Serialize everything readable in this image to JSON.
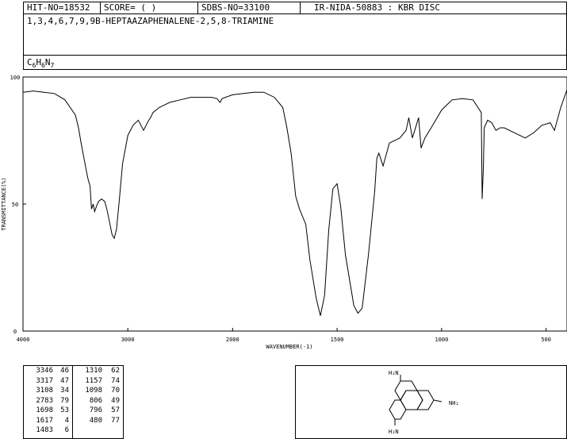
{
  "header": {
    "hit_no": "HIT-NO=18532",
    "score": "SCORE=  (   )",
    "sdbs_no": "SDBS-NO=33100",
    "ir_info": "IR-NIDA-50883 : KBR DISC",
    "compound_name": "1,3,4,6,7,9,9B-HEPTAAZAPHENALENE-2,5,8-TRIAMINE",
    "formula": {
      "c": "C",
      "c_n": "6",
      "h": "H",
      "h_n": "6",
      "n": "N",
      "n_n": "7"
    }
  },
  "chart_data": {
    "type": "line",
    "xlabel": "WAVENUMBER(-1)",
    "ylabel": "TRANSMITTANCE(%)",
    "xlim": [
      4000,
      400
    ],
    "ylim": [
      0,
      100
    ],
    "x_ticks": [
      "4000",
      "3000",
      "2000",
      "1500",
      "1000",
      "500"
    ],
    "y_ticks": [
      "100",
      "50",
      "0"
    ],
    "series": [
      {
        "x": [
          4000,
          3900,
          3800,
          3700,
          3600,
          3500,
          3470,
          3450,
          3400,
          3380,
          3360,
          3346,
          3330,
          3317,
          3300,
          3280,
          3250,
          3220,
          3200,
          3180,
          3150,
          3130,
          3108,
          3080,
          3050,
          3000,
          2950,
          2900,
          2850,
          2800,
          2783,
          2760,
          2700,
          2650,
          2600,
          2500,
          2400,
          2300,
          2200,
          2150,
          2120,
          2100,
          2000,
          1900,
          1850,
          1800,
          1760,
          1740,
          1720,
          1698,
          1680,
          1650,
          1630,
          1600,
          1580,
          1560,
          1540,
          1520,
          1500,
          1483,
          1460,
          1420,
          1400,
          1380,
          1350,
          1320,
          1310,
          1300,
          1280,
          1250,
          1200,
          1170,
          1157,
          1140,
          1110,
          1098,
          1080,
          1050,
          1000,
          950,
          900,
          850,
          810,
          806,
          800,
          796,
          780,
          760,
          740,
          720,
          700,
          650,
          600,
          560,
          520,
          480,
          460,
          430,
          400
        ],
        "y": [
          94,
          94.5,
          94,
          93.5,
          91,
          85,
          80,
          75,
          64,
          60,
          57,
          48,
          50,
          47,
          49,
          51,
          52,
          51,
          48,
          44,
          38,
          36.5,
          40,
          52,
          66,
          77,
          81,
          83,
          79,
          83,
          84,
          86,
          88,
          89,
          90,
          91,
          92,
          92,
          92,
          91.5,
          90,
          91.5,
          93,
          94,
          94,
          92,
          88,
          80,
          70,
          53,
          48,
          42,
          28,
          13,
          6,
          14,
          40,
          56,
          58,
          49,
          30,
          10,
          7,
          9,
          30,
          55,
          68,
          70,
          65,
          74,
          76,
          79,
          84,
          76,
          84,
          72,
          76,
          80,
          87,
          91,
          91.5,
          91,
          86,
          52,
          65,
          80,
          83,
          82,
          79,
          80,
          80,
          78,
          76,
          78,
          81,
          82,
          79,
          88,
          95
        ]
      }
    ]
  },
  "peak_table": [
    [
      "3346",
      "46",
      "1310",
      "62"
    ],
    [
      "3317",
      "47",
      "1157",
      "74"
    ],
    [
      "3108",
      "34",
      "1098",
      "70"
    ],
    [
      "2783",
      "79",
      "806",
      "49"
    ],
    [
      "1698",
      "53",
      "796",
      "57"
    ],
    [
      "1617",
      "4",
      "480",
      "77"
    ],
    [
      "1483",
      "6",
      "",
      ""
    ]
  ],
  "structure": {
    "top_label": "H₂N",
    "right_label": "NH₂",
    "bottom_label": "H₂N"
  }
}
